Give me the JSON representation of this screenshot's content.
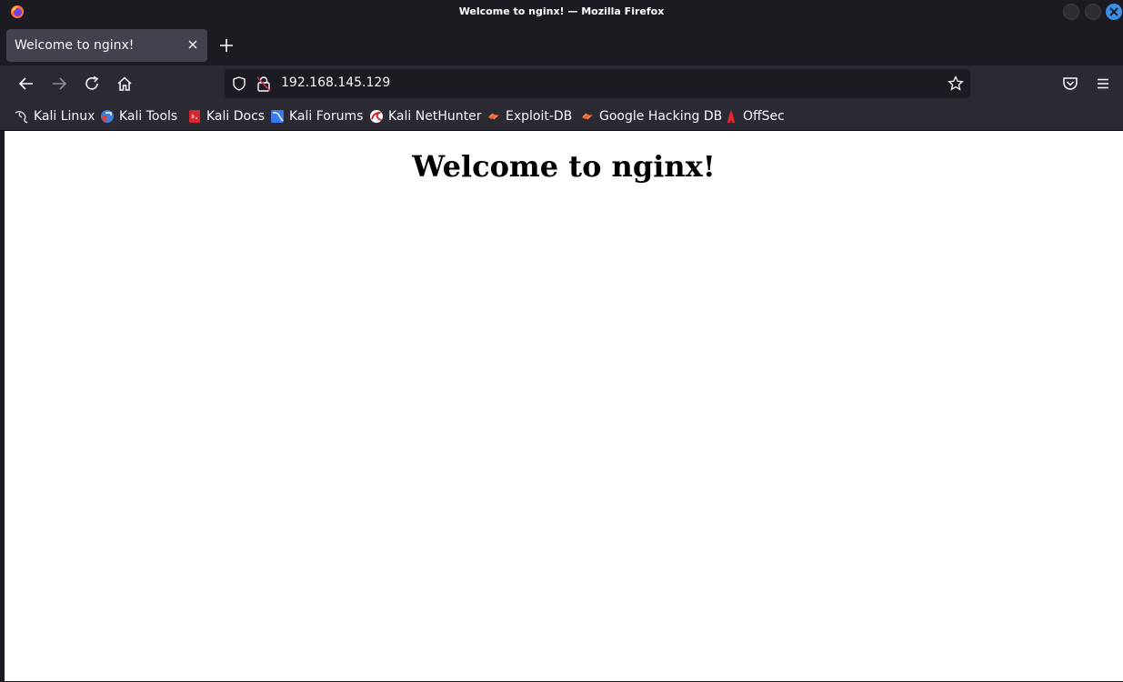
{
  "window": {
    "title": "Welcome to nginx! — Mozilla Firefox"
  },
  "tabs": [
    {
      "label": "Welcome to nginx!",
      "active": true
    }
  ],
  "navbar": {
    "url": "192.168.145.129",
    "icons": [
      "back-icon",
      "forward-icon",
      "reload-icon",
      "home-icon",
      "shield-icon",
      "insecure-lock-icon",
      "star-icon",
      "pocket-icon",
      "menu-icon"
    ]
  },
  "bookmarks": [
    {
      "label": "Kali Linux",
      "icon": "kali-dragon-icon"
    },
    {
      "label": "Kali Tools",
      "icon": "kali-tools-icon"
    },
    {
      "label": "Kali Docs",
      "icon": "kali-docs-icon"
    },
    {
      "label": "Kali Forums",
      "icon": "kali-forums-icon"
    },
    {
      "label": "Kali NetHunter",
      "icon": "nethunter-icon"
    },
    {
      "label": "Exploit-DB",
      "icon": "exploit-db-icon"
    },
    {
      "label": "Google Hacking DB",
      "icon": "ghdb-icon"
    },
    {
      "label": "OffSec",
      "icon": "offsec-icon"
    }
  ],
  "page": {
    "heading": "Welcome to nginx!"
  },
  "colors": {
    "chrome_dark": "#1c1b22",
    "toolbar": "#2b2a33",
    "tab_active": "#42414d",
    "close_button": "#3b8ee8",
    "page_background": "#ffffff"
  }
}
